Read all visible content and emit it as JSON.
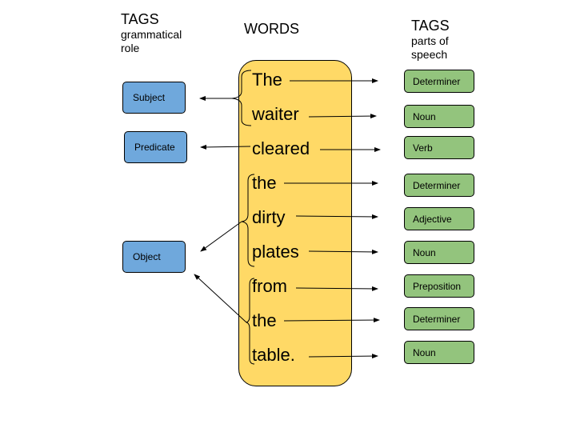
{
  "headers": {
    "role": {
      "title": "TAGS",
      "subtitle_line1": "grammatical",
      "subtitle_line2": "role"
    },
    "words": {
      "title": "WORDS"
    },
    "pos": {
      "title": "TAGS",
      "subtitle_line1": "parts of",
      "subtitle_line2": "speech"
    }
  },
  "words": [
    "The",
    "waiter",
    "cleared",
    "the",
    "dirty",
    "plates",
    "from",
    "the",
    "table."
  ],
  "roles": [
    {
      "label": "Subject",
      "covers_words": [
        0,
        1
      ]
    },
    {
      "label": "Predicate",
      "covers_words": [
        2
      ]
    },
    {
      "label": "Object",
      "covers_words": [
        3,
        4,
        5,
        6,
        7,
        8
      ]
    }
  ],
  "parts_of_speech": [
    "Determiner",
    "Noun",
    "Verb",
    "Determiner",
    "Adjective",
    "Noun",
    "Preposition",
    "Determiner",
    "Noun"
  ],
  "colors": {
    "words_panel": "#ffd966",
    "role_box": "#6fa8dc",
    "pos_box": "#93c47d"
  }
}
